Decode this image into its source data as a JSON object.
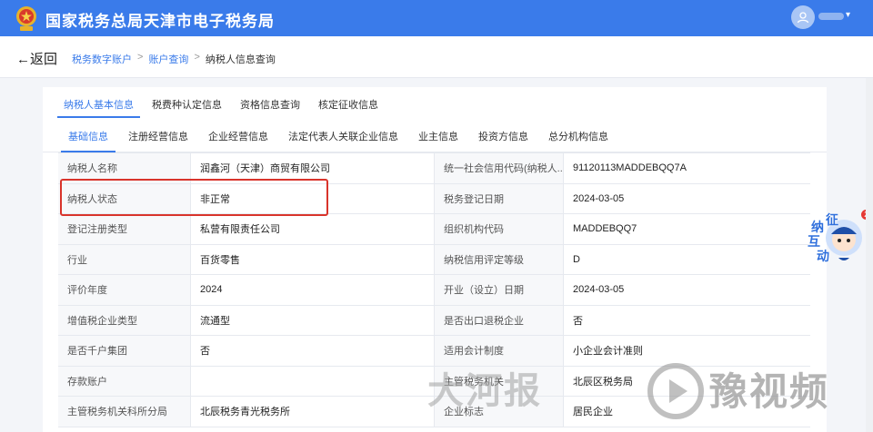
{
  "header": {
    "site_title": "国家税务总局天津市电子税务局",
    "caret": "▾"
  },
  "nav": {
    "back_label": "←返回",
    "breadcrumbs": [
      "税务数字账户",
      "账户查询",
      "纳税人信息查询"
    ],
    "sep": ">"
  },
  "tabs_primary": [
    {
      "label": "纳税人基本信息",
      "active": true
    },
    {
      "label": "税费种认定信息",
      "active": false
    },
    {
      "label": "资格信息查询",
      "active": false
    },
    {
      "label": "核定征收信息",
      "active": false
    }
  ],
  "tabs_secondary": [
    {
      "label": "基础信息",
      "active": true
    },
    {
      "label": "注册经营信息",
      "active": false
    },
    {
      "label": "企业经营信息",
      "active": false
    },
    {
      "label": "法定代表人关联企业信息",
      "active": false
    },
    {
      "label": "业主信息",
      "active": false
    },
    {
      "label": "投资方信息",
      "active": false
    },
    {
      "label": "总分机构信息",
      "active": false
    }
  ],
  "info_rows": [
    {
      "l1": "纳税人名称",
      "v1": "润鑫河（天津）商贸有限公司",
      "l2": "统一社会信用代码(纳税人...",
      "v2": "91120113MADDEBQQ7A"
    },
    {
      "l1": "纳税人状态",
      "v1": "非正常",
      "l2": "税务登记日期",
      "v2": "2024-03-05"
    },
    {
      "l1": "登记注册类型",
      "v1": "私营有限责任公司",
      "l2": "组织机构代码",
      "v2": "MADDEBQQ7"
    },
    {
      "l1": "行业",
      "v1": "百货零售",
      "l2": "纳税信用评定等级",
      "v2": "D"
    },
    {
      "l1": "评价年度",
      "v1": "2024",
      "l2": "开业（设立）日期",
      "v2": "2024-03-05"
    },
    {
      "l1": "增值税企业类型",
      "v1": "流通型",
      "l2": "是否出口退税企业",
      "v2": "否"
    },
    {
      "l1": "是否千户集团",
      "v1": "否",
      "l2": "适用会计制度",
      "v2": "小企业会计准则"
    },
    {
      "l1": "存款账户",
      "v1": "",
      "l2": "主管税务机关",
      "v2": "北辰区税务局"
    },
    {
      "l1": "主管税务机关科所分局",
      "v1": "北辰税务青光税务所",
      "l2": "企业标志",
      "v2": "居民企业"
    }
  ],
  "assistant": {
    "badge": "2",
    "chars": [
      "征",
      "纳",
      "互",
      "动"
    ]
  },
  "watermark": {
    "left": "大河报",
    "right": "豫视频"
  },
  "colors": {
    "brand": "#3a7bea",
    "highlight": "#d9342b"
  }
}
